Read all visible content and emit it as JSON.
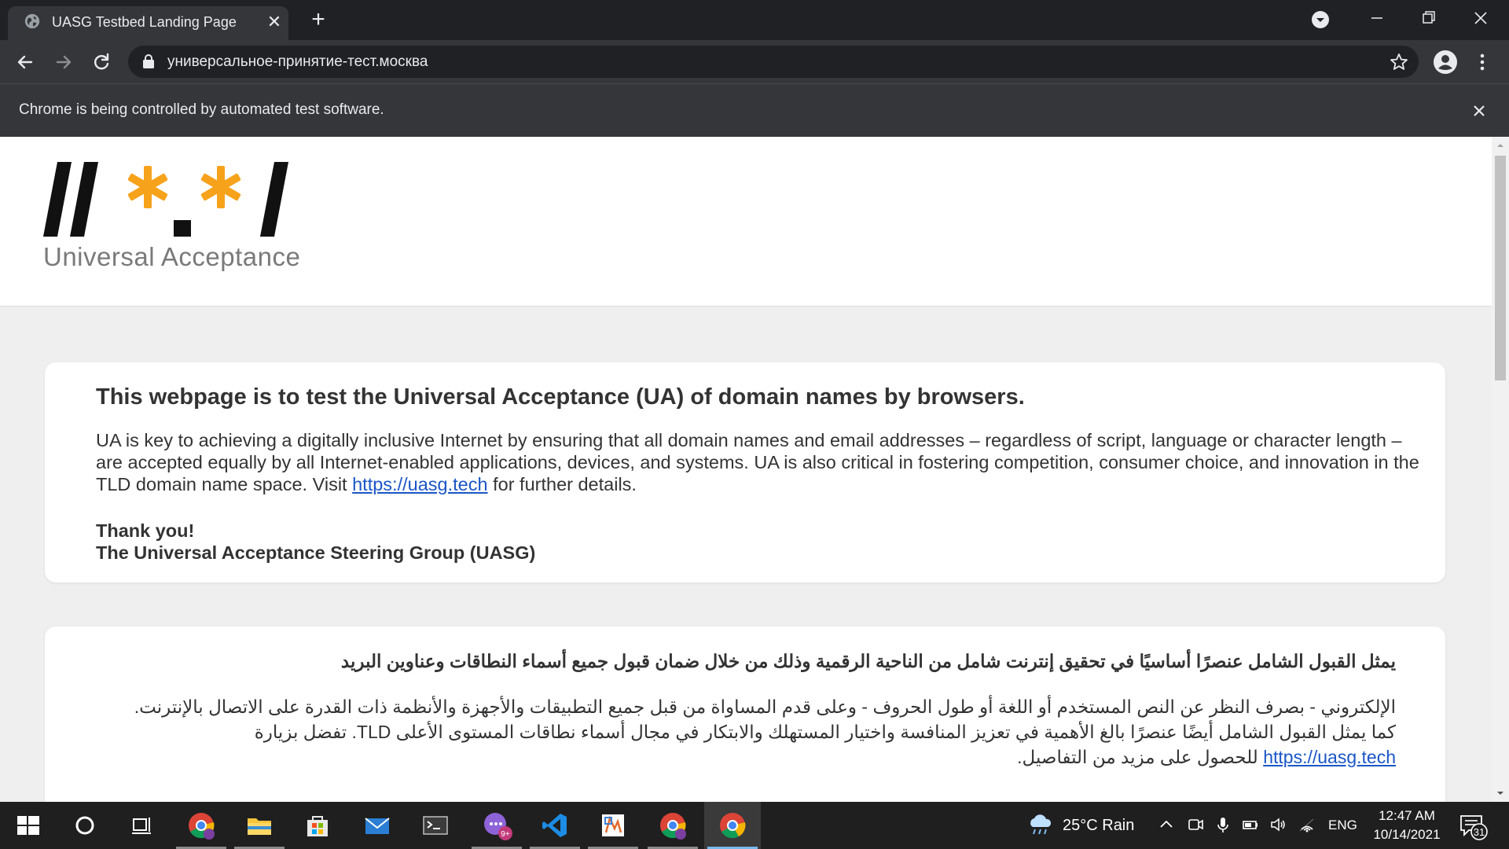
{
  "browser": {
    "tab_title": "UASG Testbed Landing Page",
    "url": "универсальное-принятие-тест.москва",
    "infobar_text": "Chrome is being controlled by automated test software."
  },
  "site": {
    "logo_text": "Universal Acceptance",
    "english": {
      "heading": "This webpage is to test the Universal Acceptance (UA) of domain names by browsers.",
      "body_before_link": "UA is key to achieving a digitally inclusive Internet by ensuring that all domain names and email addresses – regardless of script, language or character length – are accepted equally by all Internet-enabled applications, devices, and systems. UA is also critical in fostering competition, consumer choice, and innovation in the TLD domain name space. Visit ",
      "link_text": "https://uasg.tech",
      "body_after_link": " for further details.",
      "thanks": "Thank you!",
      "signature": "The Universal Acceptance Steering Group (UASG)"
    },
    "arabic": {
      "heading": "يمثل القبول الشامل عنصرًا أساسيًا في تحقيق إنترنت شامل من الناحية الرقمية وذلك من خلال ضمان قبول جميع أسماء النطاقات وعناوين البريد",
      "body_line1": "الإلكتروني - بصرف النظر عن النص المستخدم أو اللغة أو طول الحروف - وعلى قدم المساواة من قبل جميع التطبيقات والأجهزة والأنظمة ذات القدرة على الاتصال بالإنترنت.",
      "body_line2": "كما يمثل القبول الشامل أيضًا عنصرًا بالغ الأهمية في تعزيز المنافسة واختيار المستهلك والابتكار في مجال أسماء نطاقات المستوى الأعلى TLD. تفضل بزيارة",
      "link_text": "https://uasg.tech",
      "body_after_link": " للحصول على مزيد من التفاصيل."
    }
  },
  "taskbar": {
    "weather": "25°C  Rain",
    "language": "ENG",
    "time": "12:47 AM",
    "date": "10/14/2021",
    "notification_count": "31",
    "badge_count": "9+"
  },
  "colors": {
    "logo_black": "#111111",
    "logo_orange": "#f7a21b",
    "link": "#1a56c8",
    "chrome_dark": "#202124",
    "chrome_toolbar": "#35363a"
  }
}
